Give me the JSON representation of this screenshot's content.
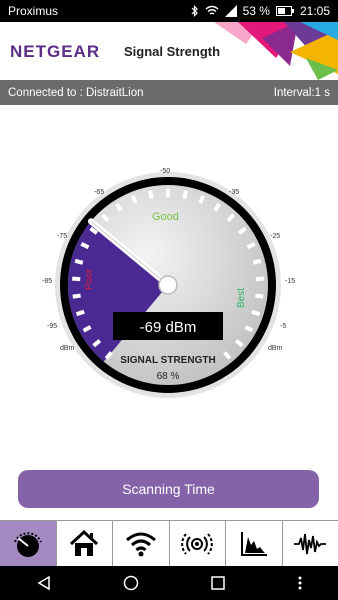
{
  "status_bar": {
    "carrier": "Proximus",
    "battery": "53 %",
    "time": "21:05"
  },
  "header": {
    "brand": "NETGEAR",
    "title": "Signal Strength"
  },
  "connection": {
    "connected_label": "Connected to : DistraitLion",
    "interval_label": "Interval:1 s"
  },
  "gauge": {
    "tick_labels": [
      "dBm",
      "-95",
      "-85",
      "-75",
      "-65",
      "-50",
      "-35",
      "-25",
      "-15",
      "-5",
      "dBm"
    ],
    "zone_good": "Good",
    "zone_best": "Best",
    "zone_poor": "Poor",
    "reading": "-69 dBm",
    "caption": "SIGNAL STRENGTH",
    "percent": "68 %",
    "level_fraction": 0.32
  },
  "scan_button_label": "Scanning Time",
  "nav_tabs": [
    "signal-meter-icon",
    "home-icon",
    "wifi-icon",
    "broadcast-icon",
    "graph-icon",
    "waveform-icon"
  ],
  "colors": {
    "brand_purple": "#5b2d86",
    "button_purple": "#8463a8",
    "arc_purple": "#4a2a92",
    "good_green": "#7ac143",
    "best_green": "#2fb56b"
  }
}
